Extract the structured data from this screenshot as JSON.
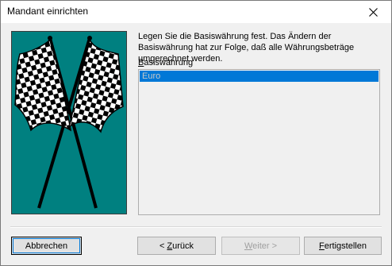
{
  "window": {
    "title": "Mandant einrichten",
    "close_icon": "close-icon"
  },
  "picture": {
    "icon": "checkered-flags-icon"
  },
  "description": "Legen Sie die Basiswährung fest. Das Ändern der Basiswährung hat zur Folge, daß alle Währungsbeträge umgerechnet werden.",
  "list": {
    "label_accel": "B",
    "label_rest": "asiswährung",
    "items": [
      "Euro"
    ],
    "selected": "Euro"
  },
  "buttons": {
    "cancel": "Abbrechen",
    "back_prefix": "< ",
    "back_accel": "Z",
    "back_rest": "urück",
    "next_accel": "W",
    "next_rest": "eiter >",
    "finish_accel": "F",
    "finish_rest": "ertigstellen"
  },
  "colors": {
    "picture_bg": "#008080",
    "selection": "#0078d7"
  }
}
